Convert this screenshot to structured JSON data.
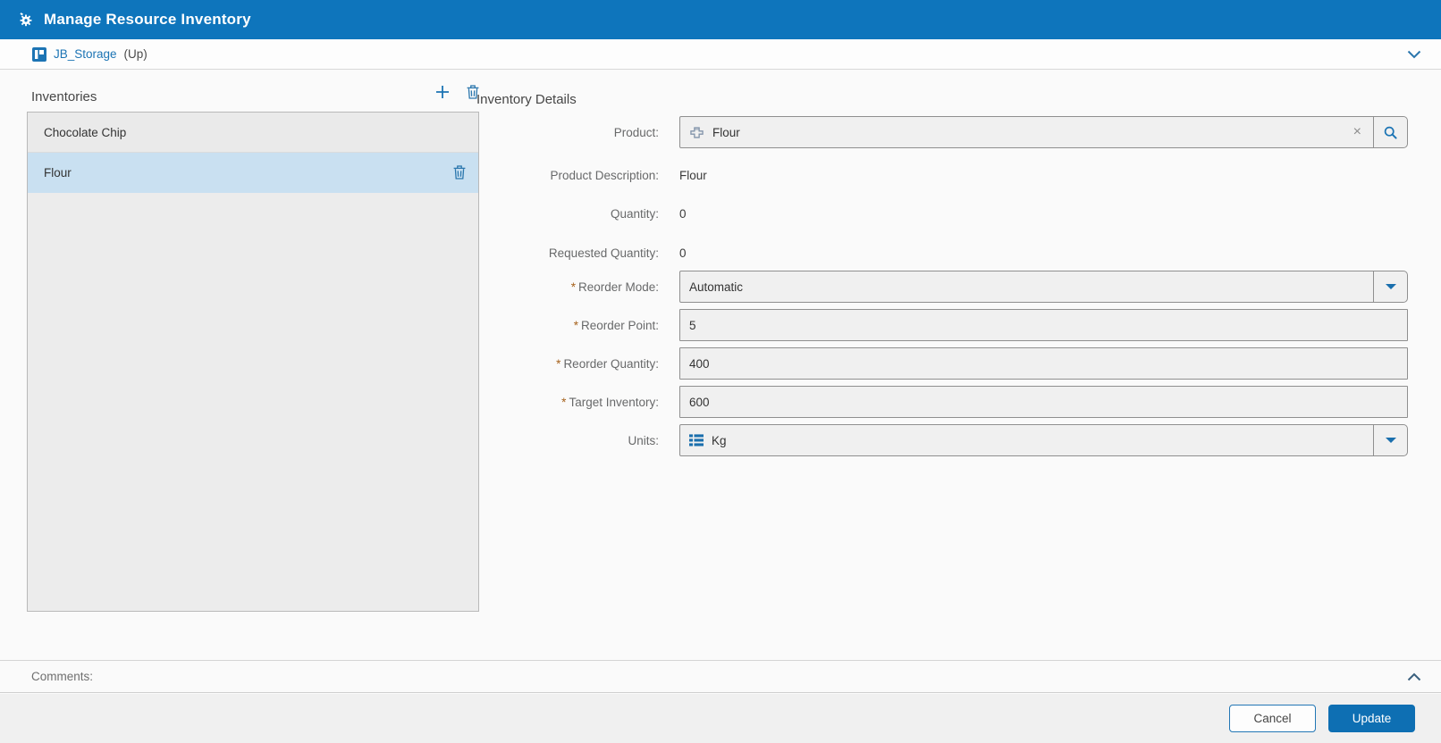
{
  "titlebar": {
    "title": "Manage Resource Inventory"
  },
  "breadcrumb": {
    "location": "JB_Storage",
    "suffix": "(Up)"
  },
  "inventories": {
    "title": "Inventories",
    "items": [
      {
        "name": "Chocolate Chip",
        "selected": false
      },
      {
        "name": "Flour",
        "selected": true
      }
    ]
  },
  "details": {
    "title": "Inventory Details",
    "required_marker": "*",
    "clear_glyph": "×",
    "fields": {
      "product": {
        "label": "Product:",
        "value": "Flour"
      },
      "product_description": {
        "label": "Product Description:",
        "value": "Flour"
      },
      "quantity": {
        "label": "Quantity:",
        "value": "0"
      },
      "requested_quantity": {
        "label": "Requested Quantity:",
        "value": "0"
      },
      "reorder_mode": {
        "label": "Reorder Mode:",
        "value": "Automatic",
        "required": true
      },
      "reorder_point": {
        "label": "Reorder Point:",
        "value": "5",
        "required": true
      },
      "reorder_quantity": {
        "label": "Reorder Quantity:",
        "value": "400",
        "required": true
      },
      "target_inventory": {
        "label": "Target Inventory:",
        "value": "600",
        "required": true
      },
      "units": {
        "label": "Units:",
        "value": "Kg"
      }
    }
  },
  "comments": {
    "label": "Comments:"
  },
  "footer": {
    "cancel_label": "Cancel",
    "update_label": "Update"
  },
  "icons": {
    "titlebar": "gear-icon",
    "breadcrumb": "storage-icon",
    "inventories_header": [
      "plus-icon",
      "trash-icon"
    ],
    "selected_row": "trash-icon",
    "product_field": [
      "product-icon",
      "clear-x-icon",
      "magnifier-icon"
    ],
    "units_field": "list-icon",
    "dropdowns": "triangle-down-icon",
    "top_right": "chevron-down-icon",
    "comments_right": "chevron-up-icon"
  },
  "colors": {
    "titlebar_bg": "#0e75bc",
    "accent_blue": "#1c74b4",
    "selected_row_bg": "#c9e0f1",
    "required_marker": "#a6621c",
    "update_button_bg": "#0e6fb3",
    "input_bg": "#f0f0f0",
    "input_border": "#8f8f8f"
  }
}
